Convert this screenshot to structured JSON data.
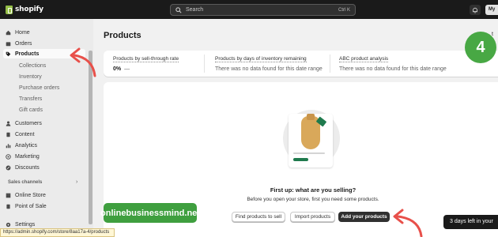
{
  "topbar": {
    "logo_text": "shopify",
    "search_placeholder": "Search",
    "search_shortcut": "Ctrl K",
    "store_button": "My"
  },
  "sidebar": {
    "items": [
      {
        "label": "Home",
        "icon": "home-icon"
      },
      {
        "label": "Orders",
        "icon": "orders-icon"
      },
      {
        "label": "Products",
        "icon": "tag-icon",
        "active": true
      },
      {
        "label": "Collections",
        "sub": true
      },
      {
        "label": "Inventory",
        "sub": true
      },
      {
        "label": "Purchase orders",
        "sub": true
      },
      {
        "label": "Transfers",
        "sub": true
      },
      {
        "label": "Gift cards",
        "sub": true
      },
      {
        "label": "Customers",
        "icon": "person-icon"
      },
      {
        "label": "Content",
        "icon": "content-icon"
      },
      {
        "label": "Analytics",
        "icon": "chart-icon"
      },
      {
        "label": "Marketing",
        "icon": "target-icon"
      },
      {
        "label": "Discounts",
        "icon": "discount-icon"
      }
    ],
    "sales_channels_label": "Sales channels",
    "channels": [
      {
        "label": "Online Store",
        "icon": "store-icon"
      },
      {
        "label": "Point of Sale",
        "icon": "pos-icon"
      }
    ],
    "settings_label": "Settings"
  },
  "main": {
    "title": "Products",
    "header_cut_text": "t",
    "metrics": [
      {
        "label": "Products by sell-through rate",
        "value": "0%",
        "extra": "—"
      },
      {
        "label": "Products by days of inventory remaining",
        "value": "There was no data found for this date range"
      },
      {
        "label": "ABC product analysis",
        "value": "There was no data found for this date range"
      }
    ],
    "empty_state": {
      "title": "First up: what are you selling?",
      "subtitle": "Before you open your store, first you need some products.",
      "buttons": {
        "find": "Find products to sell",
        "import": "Import products",
        "add": "Add your products"
      }
    }
  },
  "overlays": {
    "watermark": "onlinebusinessmind.net",
    "step_number": "4",
    "trial_text": "3 days left in your",
    "status_url": "https://admin.shopify.com/store/8aa17a-4/products"
  },
  "colors": {
    "topbar": "#1a1a1a",
    "brand_green": "#95bf47",
    "annotation_red": "#e8504a",
    "badge_green": "#48a844"
  }
}
